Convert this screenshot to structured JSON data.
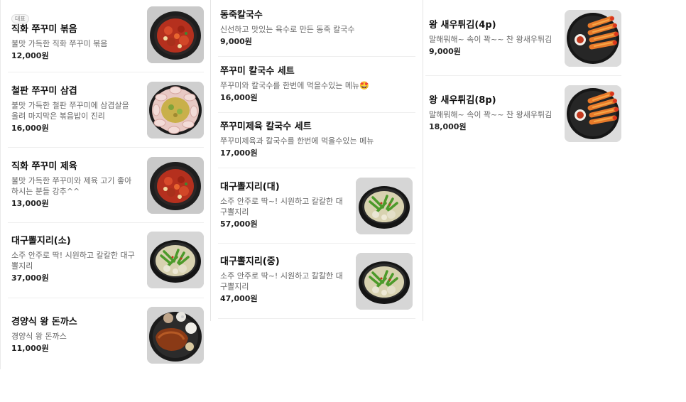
{
  "columns": [
    {
      "items": [
        {
          "badge": "대표",
          "name": "직화 쭈꾸미 볶음",
          "desc": "불맛 가득한 직화 쭈꾸미 볶음",
          "price": "12,000원",
          "thumb_icon": "spicy-stirfry-icon"
        },
        {
          "name": "철판 쭈꾸미 삼겹",
          "desc": "불맛 가득한 철판 쭈꾸미에 삼겹살을 올려 마지막은 볶음밥이 진리",
          "price": "16,000원",
          "thumb_icon": "pork-belly-pan-icon"
        },
        {
          "name": "직화 쭈꾸미 제육",
          "desc": "불맛 가득한 쭈꾸미와 제육 고기 좋아하시는 분들 강추^^",
          "price": "13,000원",
          "thumb_icon": "spicy-stirfry-icon"
        },
        {
          "name": "대구뽈지리(소)",
          "desc": "소주 안주로 딱! 시원하고 칼칼한 대구뽈지리",
          "price": "37,000원",
          "thumb_icon": "fish-soup-icon"
        },
        {
          "name": "경양식 왕 돈까스",
          "desc": "경양식 왕 돈까스",
          "price": "11,000원",
          "thumb_icon": "pork-cutlet-icon"
        }
      ]
    },
    {
      "items": [
        {
          "name": "동죽칼국수",
          "desc": "신선하고 맛있는 육수로 만든 동죽 칼국수",
          "price": "9,000원"
        },
        {
          "name": "쭈꾸미 칼국수 세트",
          "desc": "쭈꾸미와 칼국수를 한번에 먹을수있는 메뉴🤩",
          "price": "16,000원"
        },
        {
          "name": "쭈꾸미제육 칼국수 세트",
          "desc": "쭈꾸미제육과 칼국수를 한번에 먹을수있는 메뉴",
          "price": "17,000원"
        },
        {
          "name": "대구뽈지리(대)",
          "desc": "소주 안주로 딱~! 시원하고 칼칼한 대구뽈지리",
          "price": "57,000원",
          "thumb_icon": "fish-soup-icon"
        },
        {
          "name": "대구뽈지리(중)",
          "desc": "소주 안주로 딱~! 시원하고 칼칼한 대구뽈지리",
          "price": "47,000원",
          "thumb_icon": "fish-soup-icon"
        }
      ]
    },
    {
      "items": [
        {
          "name": "왕 새우튀김(4p)",
          "desc": "말해뭐해~ 속이 꽉~~ 찬 왕새우튀김",
          "price": "9,000원",
          "thumb_icon": "fried-shrimp-icon"
        },
        {
          "name": "왕 새우튀김(8p)",
          "desc": "말해뭐해~ 속이 꽉~~ 찬 왕새우튀김",
          "price": "18,000원",
          "thumb_icon": "fried-shrimp-icon"
        }
      ]
    }
  ]
}
